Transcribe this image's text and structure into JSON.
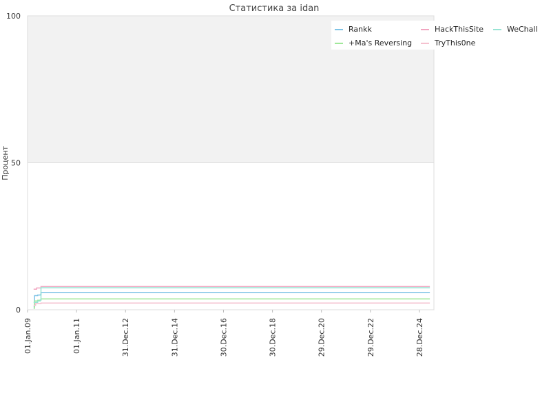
{
  "chart_data": {
    "type": "line",
    "title": "Статистика за idan",
    "xlabel": "",
    "ylabel": "Процент",
    "ylim": [
      0,
      100
    ],
    "y_ticks": [
      0,
      50,
      100
    ],
    "x_range": [
      "2009-01-01",
      "2025-08-01"
    ],
    "x_ticks": [
      {
        "date": "2009-01-01",
        "label": "01.Jan.09"
      },
      {
        "date": "2011-01-01",
        "label": "01.Jan.11"
      },
      {
        "date": "2012-12-31",
        "label": "31.Dec.12"
      },
      {
        "date": "2014-12-31",
        "label": "31.Dec.14"
      },
      {
        "date": "2016-12-30",
        "label": "30.Dec.16"
      },
      {
        "date": "2018-12-30",
        "label": "30.Dec.18"
      },
      {
        "date": "2020-12-29",
        "label": "29.Dec.20"
      },
      {
        "date": "2022-12-29",
        "label": "29.Dec.22"
      },
      {
        "date": "2024-12-28",
        "label": "28.Dec.24"
      }
    ],
    "grid": true,
    "legend_position": "top-right",
    "series": [
      {
        "name": "Rankk",
        "color": "#7ec3e6",
        "points": [
          [
            "2009-04-01",
            1.0
          ],
          [
            "2009-04-15",
            4.8
          ],
          [
            "2009-06-01",
            5.0
          ],
          [
            "2009-07-10",
            5.1
          ],
          [
            "2009-07-20",
            5.9
          ],
          [
            "2025-06-01",
            5.9
          ]
        ]
      },
      {
        "name": "+Ma's Reversing",
        "color": "#a0e89a",
        "points": [
          [
            "2009-04-01",
            0.5
          ],
          [
            "2009-04-15",
            3.0
          ],
          [
            "2009-06-01",
            3.2
          ],
          [
            "2009-07-10",
            3.3
          ],
          [
            "2009-07-20",
            3.7
          ],
          [
            "2025-06-01",
            3.7
          ]
        ]
      },
      {
        "name": "HackThisSite",
        "color": "#f1a5c0",
        "points": [
          [
            "2009-04-01",
            7.0
          ],
          [
            "2009-05-15",
            7.4
          ],
          [
            "2009-07-20",
            7.9
          ],
          [
            "2025-06-01",
            7.9
          ]
        ]
      },
      {
        "name": "TryThis0ne",
        "color": "#f5c1cf",
        "points": [
          [
            "2009-04-01",
            1.5
          ],
          [
            "2009-05-01",
            2.1
          ],
          [
            "2009-07-20",
            2.3
          ],
          [
            "2025-06-01",
            2.3
          ]
        ]
      },
      {
        "name": "WeChall",
        "color": "#98e4d4",
        "points": [
          [
            "2009-04-01",
            2.5
          ],
          [
            "2009-06-01",
            3.0
          ],
          [
            "2009-07-10",
            3.3
          ],
          [
            "2009-07-20",
            7.5
          ],
          [
            "2025-06-01",
            7.5
          ]
        ]
      }
    ]
  }
}
